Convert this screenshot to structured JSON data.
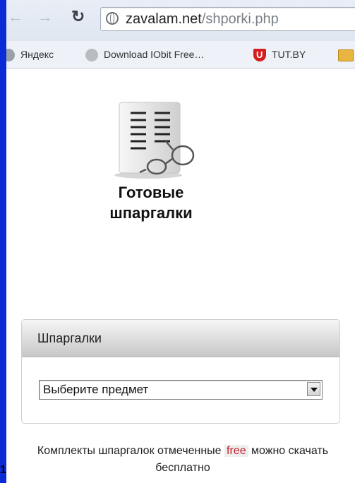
{
  "browser": {
    "url_host": "zavalam.net",
    "url_path": "/shporki.php",
    "bookmarks": [
      {
        "label": "Яндекс",
        "icon": "yandex-icon"
      },
      {
        "label": "Download IObit Free…",
        "icon": "person-icon"
      },
      {
        "label": "TUT.BY",
        "icon": "tutby-icon"
      },
      {
        "label": "",
        "icon": "folder-icon"
      }
    ]
  },
  "page": {
    "logo_title_line1": "Готовые",
    "logo_title_line2": "шпаргалки",
    "panel_title": "Шпаргалки",
    "select_value": "Выберите предмет",
    "footer_before": "Комплекты шпаргалок отмеченные",
    "footer_badge": "free",
    "footer_after": "можно скачать бесплатно",
    "corner_text": "1"
  }
}
